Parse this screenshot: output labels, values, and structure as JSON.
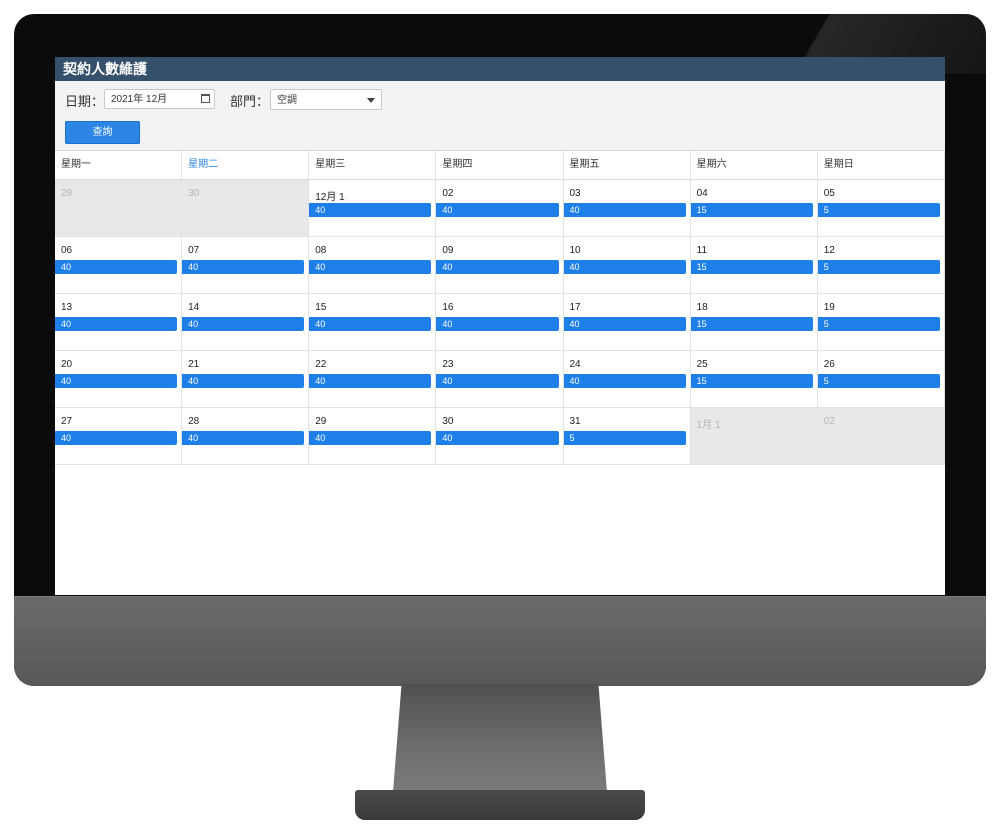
{
  "page": {
    "title": "契約人數維護"
  },
  "filters": {
    "date_label": "日期：",
    "date_value": "2021年 12月",
    "dept_label": "部門：",
    "dept_value": "空調"
  },
  "buttons": {
    "query": "查詢"
  },
  "calendar": {
    "weekdays": [
      "星期一",
      "星期二",
      "星期三",
      "星期四",
      "星期五",
      "星期六",
      "星期日"
    ],
    "weeks": [
      [
        {
          "day": "29",
          "value": "",
          "other": true
        },
        {
          "day": "30",
          "value": "",
          "other": true
        },
        {
          "day": "12月 1",
          "value": "40"
        },
        {
          "day": "02",
          "value": "40"
        },
        {
          "day": "03",
          "value": "40"
        },
        {
          "day": "04",
          "value": "15"
        },
        {
          "day": "05",
          "value": "5"
        }
      ],
      [
        {
          "day": "06",
          "value": "40"
        },
        {
          "day": "07",
          "value": "40"
        },
        {
          "day": "08",
          "value": "40"
        },
        {
          "day": "09",
          "value": "40"
        },
        {
          "day": "10",
          "value": "40"
        },
        {
          "day": "11",
          "value": "15"
        },
        {
          "day": "12",
          "value": "5"
        }
      ],
      [
        {
          "day": "13",
          "value": "40"
        },
        {
          "day": "14",
          "value": "40"
        },
        {
          "day": "15",
          "value": "40"
        },
        {
          "day": "16",
          "value": "40"
        },
        {
          "day": "17",
          "value": "40"
        },
        {
          "day": "18",
          "value": "15"
        },
        {
          "day": "19",
          "value": "5"
        }
      ],
      [
        {
          "day": "20",
          "value": "40"
        },
        {
          "day": "21",
          "value": "40"
        },
        {
          "day": "22",
          "value": "40"
        },
        {
          "day": "23",
          "value": "40"
        },
        {
          "day": "24",
          "value": "40"
        },
        {
          "day": "25",
          "value": "15"
        },
        {
          "day": "26",
          "value": "5"
        }
      ],
      [
        {
          "day": "27",
          "value": "40"
        },
        {
          "day": "28",
          "value": "40"
        },
        {
          "day": "29",
          "value": "40"
        },
        {
          "day": "30",
          "value": "40"
        },
        {
          "day": "31",
          "value": "5"
        },
        {
          "day": "1月 1",
          "value": "",
          "other": true
        },
        {
          "day": "02",
          "value": "",
          "other": true
        }
      ]
    ]
  },
  "colors": {
    "title_bar": "#35506b",
    "accent": "#1e7fe8",
    "other_month": "#e8e8e8"
  }
}
